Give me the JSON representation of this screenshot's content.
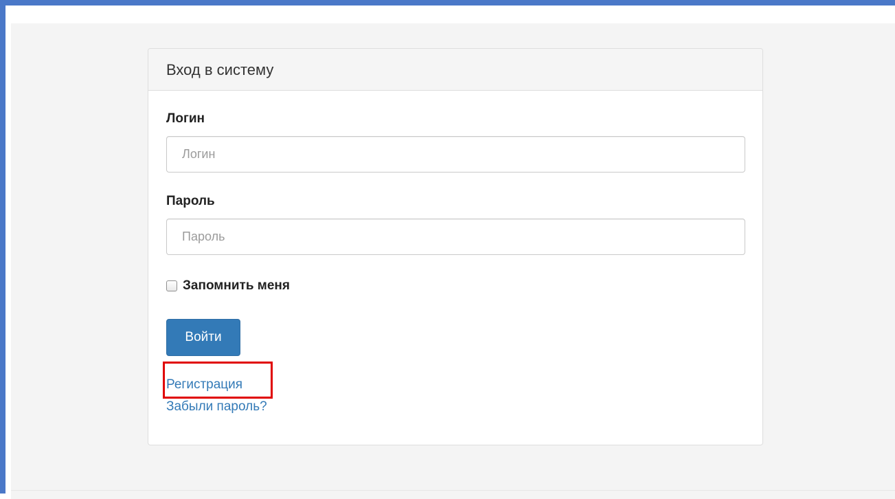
{
  "login_panel": {
    "title": "Вход в систему",
    "login": {
      "label": "Логин",
      "placeholder": "Логин",
      "value": ""
    },
    "password": {
      "label": "Пароль",
      "placeholder": "Пароль",
      "value": ""
    },
    "remember_me": {
      "label": "Запомнить меня",
      "checked": false
    },
    "submit_label": "Войти",
    "links": {
      "register": "Регистрация",
      "forgot_password": "Забыли пароль?"
    }
  },
  "colors": {
    "accent": "#337ab7",
    "window_border": "#4a78c8",
    "highlight": "#e00000"
  }
}
